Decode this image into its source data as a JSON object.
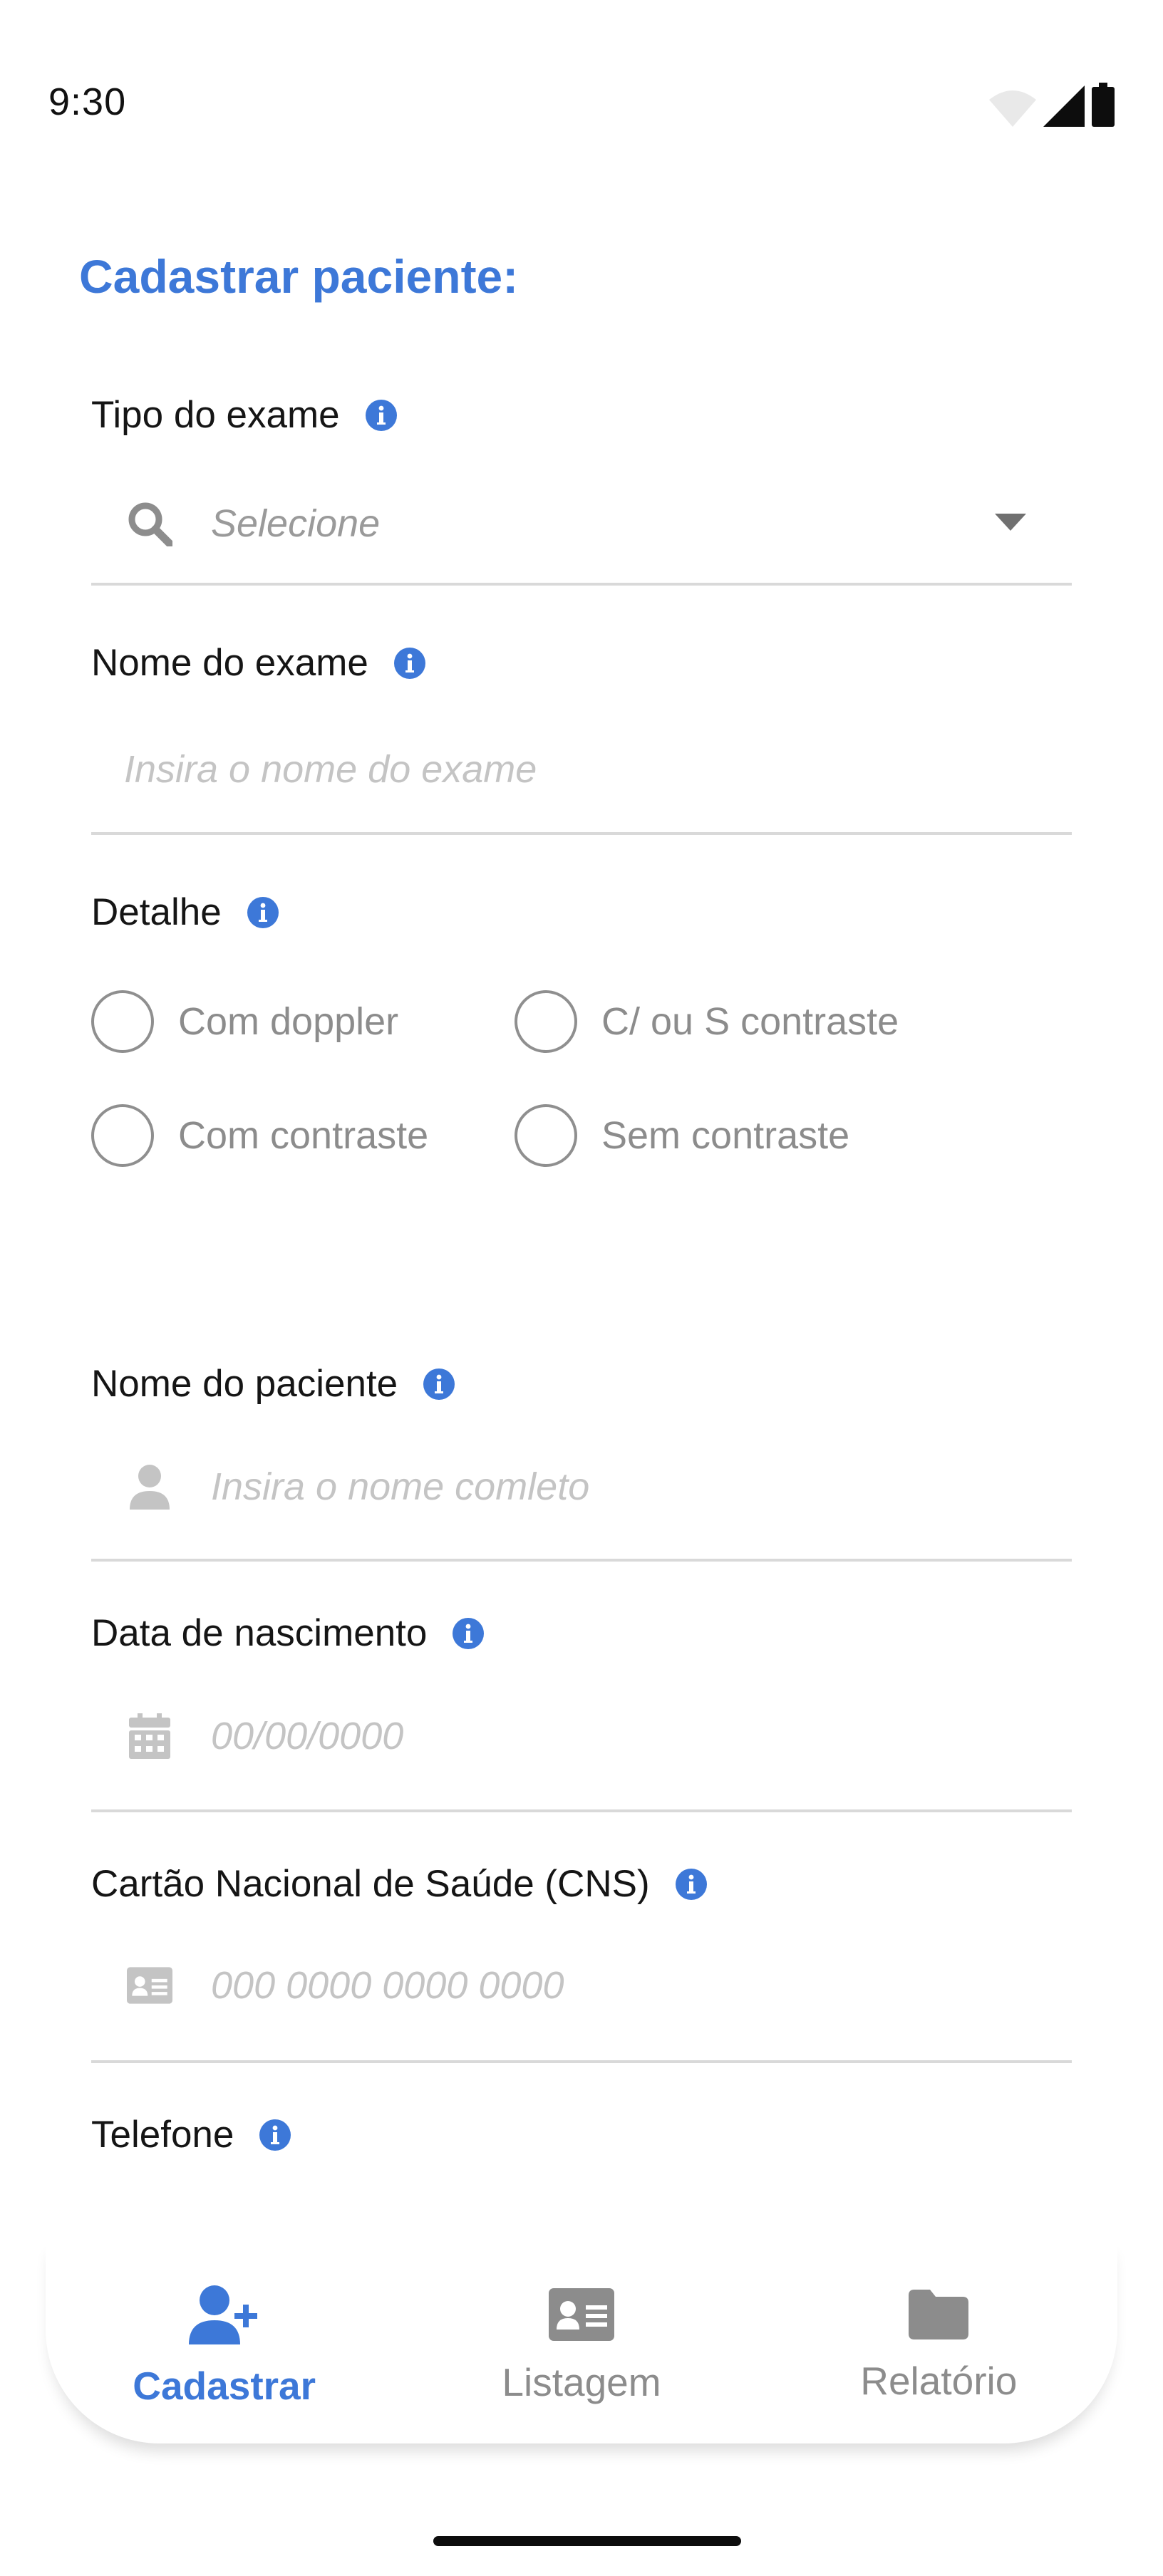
{
  "status_bar": {
    "time": "9:30"
  },
  "page": {
    "title": "Cadastrar paciente:"
  },
  "form": {
    "exam_type": {
      "label": "Tipo do exame",
      "placeholder": "Selecione"
    },
    "exam_name": {
      "label": "Nome do exame",
      "placeholder": "Insira o nome do exame"
    },
    "detail": {
      "label": "Detalhe",
      "options": [
        "Com doppler",
        "C/ ou S contraste",
        "Com contraste",
        "Sem contraste"
      ]
    },
    "patient_name": {
      "label": "Nome do paciente",
      "placeholder": "Insira o nome comleto"
    },
    "birth_date": {
      "label": "Data de nascimento",
      "placeholder": "00/00/0000"
    },
    "cns": {
      "label": "Cartão Nacional de Saúde (CNS)",
      "placeholder": "000 0000 0000 0000"
    },
    "phone": {
      "label": "Telefone"
    }
  },
  "bottom_nav": {
    "items": [
      {
        "label": "Cadastrar",
        "icon": "user-plus-icon",
        "active": true
      },
      {
        "label": "Listagem",
        "icon": "id-card-icon",
        "active": false
      },
      {
        "label": "Relatório",
        "icon": "folder-icon",
        "active": false
      }
    ]
  },
  "colors": {
    "accent": "#3d78d8",
    "muted": "#8c8c8c",
    "divider": "#d9d9d9"
  }
}
